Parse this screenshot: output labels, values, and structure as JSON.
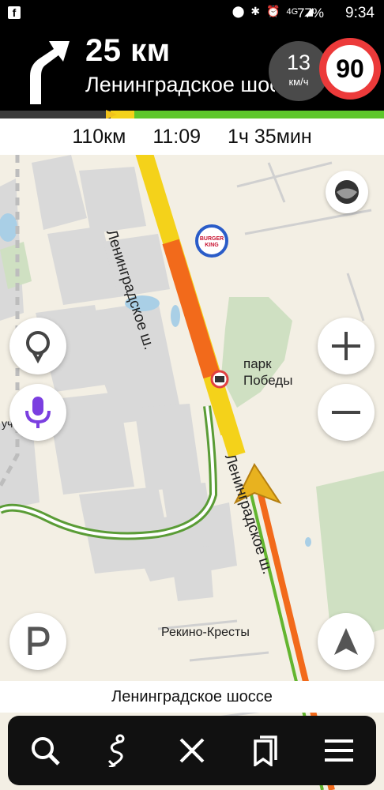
{
  "status_bar": {
    "network": "4G",
    "battery": "77%",
    "time": "9:34"
  },
  "navigation": {
    "distance_to_turn": "25 км",
    "next_street": "Ленинградское шоссе",
    "current_speed": "13",
    "speed_unit": "км/ч",
    "speed_limit": "90"
  },
  "eta": {
    "remaining_distance": "110км",
    "arrival_time": "11:09",
    "remaining_time": "1ч 35мин"
  },
  "map": {
    "road_label": "Ленинградское ш.",
    "road_label_2": "Ленинградское ш.",
    "park_label": "парк\nПобеды",
    "village_label": "Рекино-Кресты",
    "edge_label": "уч.",
    "poi": "BURGER KING"
  },
  "current_street": "Ленинградское шоссе",
  "toolbar": {
    "icons": [
      "search-icon",
      "route-icon",
      "close-icon",
      "bookmarks-icon",
      "menu-icon"
    ]
  },
  "colors": {
    "accent_red": "#ec3a3a",
    "voice_purple": "#7b3fe0",
    "route_yellow": "#f4d21a",
    "traffic_orange": "#f26a1b",
    "traffic_green": "#63b52f"
  }
}
